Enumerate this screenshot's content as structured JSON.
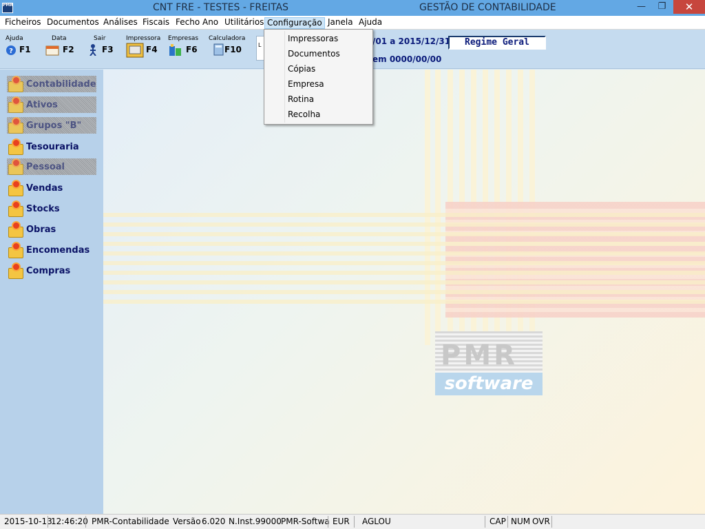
{
  "window": {
    "app_icon_text": "PMR",
    "title_left": "CNT FRE - TESTES - FREITAS",
    "title_right": "GESTÃO DE CONTABILIDADE",
    "min_glyph": "—",
    "max_glyph": "❐",
    "close_glyph": "✕"
  },
  "menu": {
    "items": [
      "Ficheiros",
      "Documentos",
      "Análises",
      "Fiscais",
      "Fecho Ano",
      "Utilitários",
      "Configuração",
      "Janela",
      "Ajuda"
    ],
    "active": "Configuração"
  },
  "dropdown": {
    "items": [
      "Impressoras",
      "Documentos",
      "Cópias",
      "Empresa",
      "Rotina",
      "Recolha"
    ]
  },
  "toolbar": {
    "buttons": [
      {
        "caption": "Ajuda",
        "key": "F1",
        "icon": "help-icon"
      },
      {
        "caption": "Data",
        "key": "F2",
        "icon": "calendar-icon"
      },
      {
        "caption": "Sair",
        "key": "F3",
        "icon": "exit-icon"
      },
      {
        "caption": "Impressora",
        "key": "F4",
        "icon": "printer-icon"
      },
      {
        "caption": "Empresas",
        "key": "F6",
        "icon": "companies-icon"
      },
      {
        "caption": "Calculadora",
        "key": "F10",
        "icon": "calculator-icon"
      }
    ],
    "infobox_text": "L",
    "period_text": "/01 a 2015/12/31",
    "regime": "Regime Geral",
    "closed_text": "em 0000/00/00"
  },
  "sidebar": {
    "items": [
      {
        "label": "Contabilidade",
        "enabled": false
      },
      {
        "label": "Ativos",
        "enabled": false
      },
      {
        "label": "Grupos \"B\"",
        "enabled": false
      },
      {
        "label": "Tesouraria",
        "enabled": true
      },
      {
        "label": "Pessoal",
        "enabled": false
      },
      {
        "label": "Vendas",
        "enabled": true
      },
      {
        "label": "Stocks",
        "enabled": true
      },
      {
        "label": "Obras",
        "enabled": true
      },
      {
        "label": "Encomendas",
        "enabled": true
      },
      {
        "label": "Compras",
        "enabled": true
      }
    ]
  },
  "logo": {
    "top_text": "PMR",
    "bottom_text": "software"
  },
  "statusbar": {
    "date": "2015-10-13",
    "time": "12:46:20",
    "product": "PMR-Contabilidade",
    "version_label": "Versão",
    "version": "6.020",
    "install": "N.Inst.99000",
    "vendor": "PMR-Softwa",
    "currency": "EUR",
    "user": "AGLOU",
    "cap": "CAP",
    "num": "NUM",
    "ovr": "OVR"
  }
}
